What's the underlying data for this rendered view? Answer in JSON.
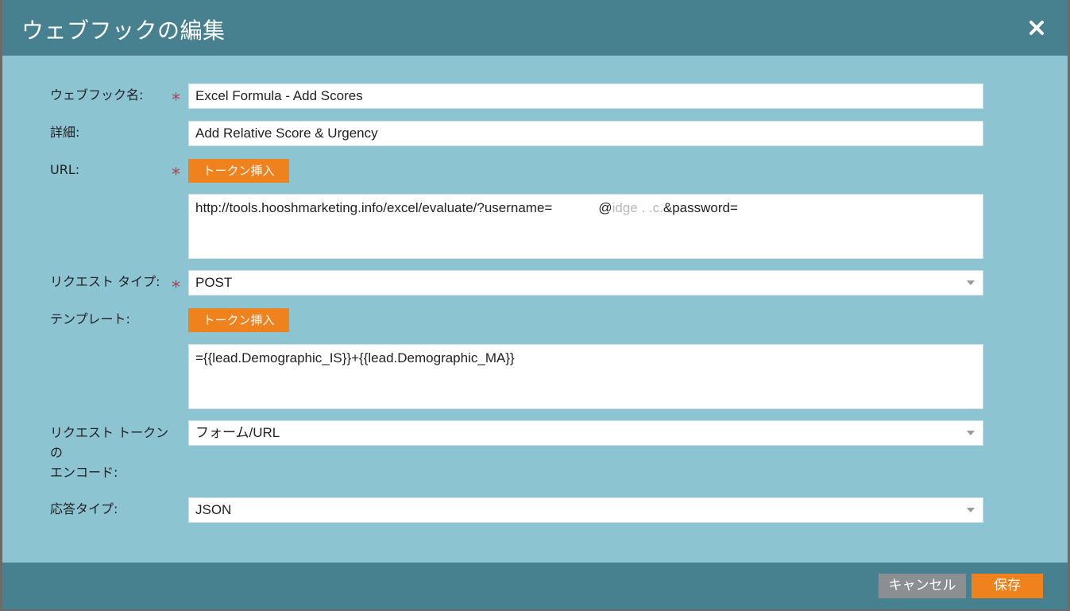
{
  "dialog": {
    "title": "ウェブフックの編集"
  },
  "form": {
    "name": {
      "label": "ウェブフック名:",
      "required_mark": "*",
      "value": "Excel Formula - Add Scores"
    },
    "description": {
      "label": "詳細:",
      "value": "Add Relative Score & Urgency"
    },
    "url": {
      "label": "URL:",
      "required_mark": "*",
      "insert_token_label": "トークン挿入",
      "value_prefix": "http://tools.hooshmarketing.info/excel/evaluate/?username=",
      "value_mid": "@",
      "value_mid_faint": "idge  .  .c.",
      "value_suffix": "&password="
    },
    "request_type": {
      "label": "リクエスト タイプ:",
      "required_mark": "*",
      "value": "POST"
    },
    "template": {
      "label": "テンプレート:",
      "insert_token_label": "トークン挿入",
      "value": "={{lead.Demographic_IS}}+{{lead.Demographic_MA}}"
    },
    "request_token_encoding": {
      "label_line1": "リクエスト トークン",
      "label_line2": "の",
      "label_line3": "エンコード:",
      "value": "フォーム/URL"
    },
    "response_type": {
      "label": "応答タイプ:",
      "value": "JSON"
    }
  },
  "footer": {
    "cancel_label": "キャンセル",
    "save_label": "保存"
  },
  "icons": {
    "close": "close-icon",
    "dropdown": "chevron-down-icon"
  },
  "colors": {
    "header_bg": "#47818f",
    "body_bg": "#8cc4d2",
    "accent_orange": "#f0821e",
    "required_red": "#c0394b",
    "cancel_gray": "#8b8f92"
  }
}
